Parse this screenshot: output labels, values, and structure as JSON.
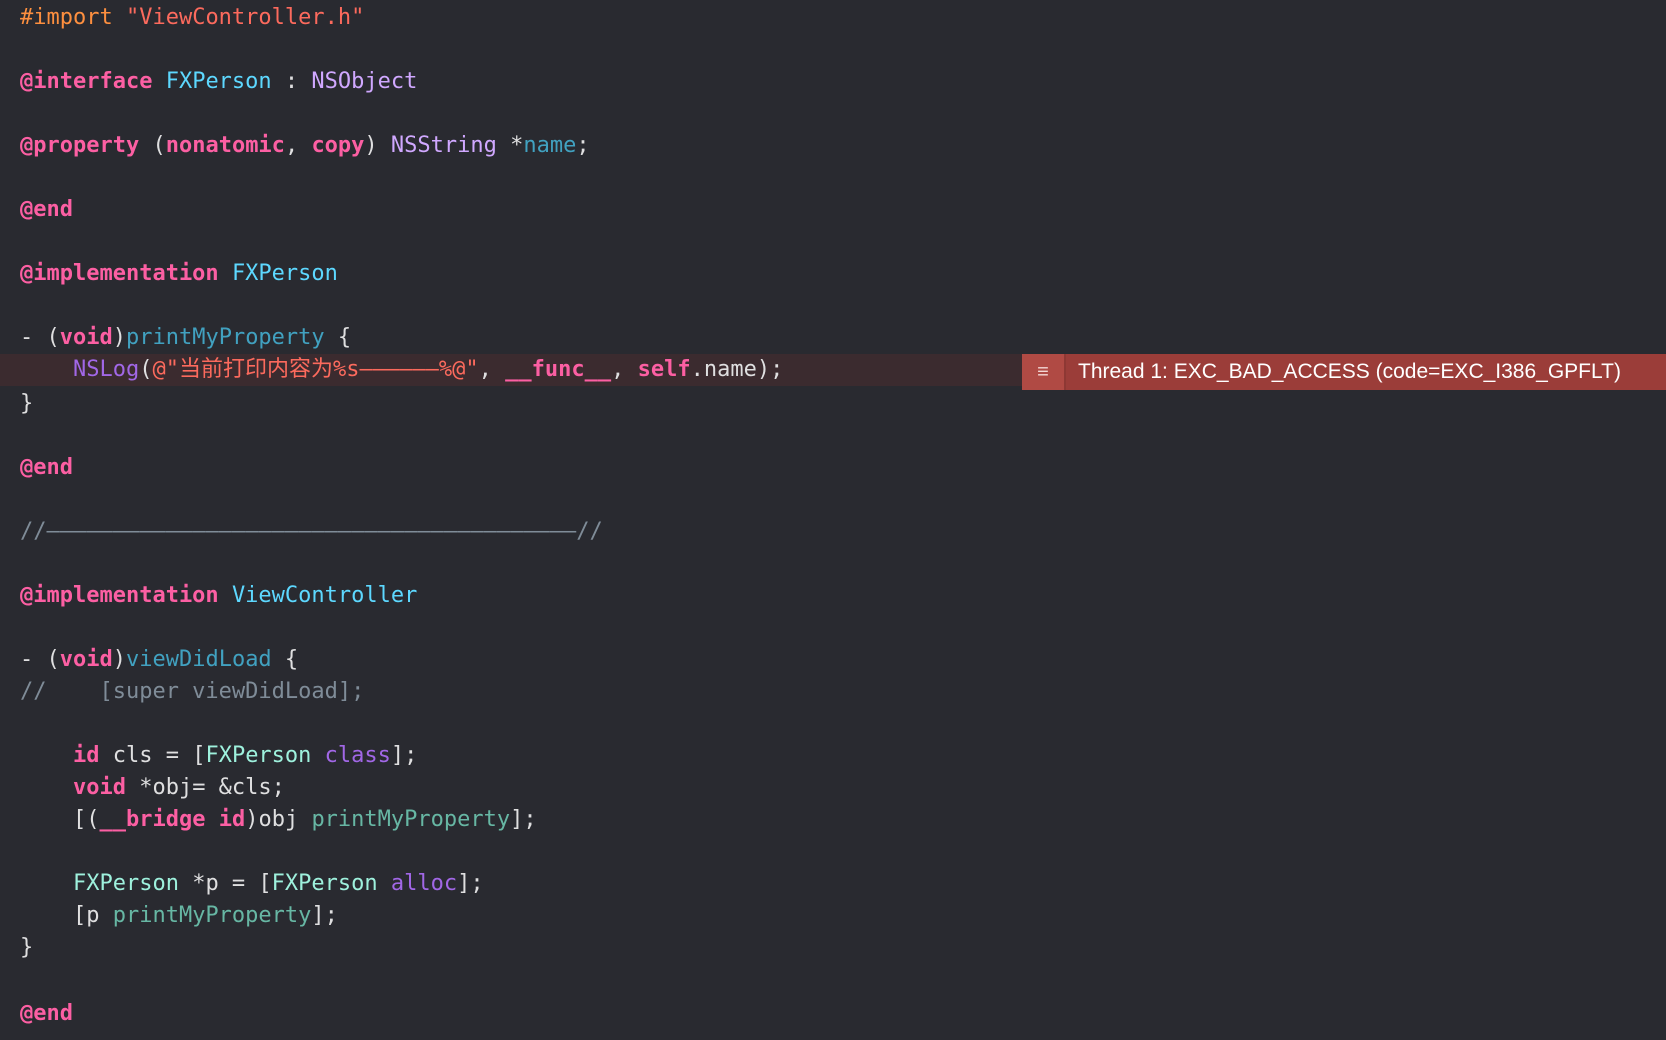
{
  "code_lines": [
    [
      [
        "t-pre",
        "#import "
      ],
      [
        "t-str",
        "\"ViewController.h\""
      ]
    ],
    [],
    [
      [
        "t-kw",
        "@interface"
      ],
      [
        "t-plain",
        " "
      ],
      [
        "t-decl",
        "FXPerson"
      ],
      [
        "t-plain",
        " : "
      ],
      [
        "t-type",
        "NSObject"
      ]
    ],
    [],
    [
      [
        "t-kw",
        "@property"
      ],
      [
        "t-plain",
        " ("
      ],
      [
        "t-kw",
        "nonatomic"
      ],
      [
        "t-plain",
        ", "
      ],
      [
        "t-kw",
        "copy"
      ],
      [
        "t-plain",
        ") "
      ],
      [
        "t-type",
        "NSString"
      ],
      [
        "t-plain",
        " *"
      ],
      [
        "t-prop",
        "name"
      ],
      [
        "t-plain",
        ";"
      ]
    ],
    [],
    [
      [
        "t-kw",
        "@end"
      ]
    ],
    [],
    [
      [
        "t-kw",
        "@implementation"
      ],
      [
        "t-plain",
        " "
      ],
      [
        "t-decl",
        "FXPerson"
      ]
    ],
    [],
    [
      [
        "t-plain",
        "- ("
      ],
      [
        "t-kw",
        "void"
      ],
      [
        "t-plain",
        ")"
      ],
      [
        "t-prop",
        "printMyProperty"
      ],
      [
        "t-plain",
        " {"
      ]
    ],
    [
      [
        "t-plain",
        "    "
      ],
      [
        "t-sysm",
        "NSLog"
      ],
      [
        "t-plain",
        "("
      ],
      [
        "t-str",
        "@\"当前打印内容为%s——————%@\""
      ],
      [
        "t-plain",
        ", "
      ],
      [
        "t-kw",
        "__func__"
      ],
      [
        "t-plain",
        ", "
      ],
      [
        "t-kw",
        "self"
      ],
      [
        "t-plain",
        ".name);"
      ]
    ],
    [
      [
        "t-plain",
        "}"
      ]
    ],
    [],
    [
      [
        "t-kw",
        "@end"
      ]
    ],
    [],
    [
      [
        "t-com",
        "//————————————————————————————————————————//"
      ]
    ],
    [],
    [
      [
        "t-kw",
        "@implementation"
      ],
      [
        "t-plain",
        " "
      ],
      [
        "t-decl",
        "ViewController"
      ]
    ],
    [],
    [
      [
        "t-plain",
        "- ("
      ],
      [
        "t-kw",
        "void"
      ],
      [
        "t-plain",
        ")"
      ],
      [
        "t-prop",
        "viewDidLoad"
      ],
      [
        "t-plain",
        " {"
      ]
    ],
    [
      [
        "t-com",
        "//    [super viewDidLoad];"
      ]
    ],
    [],
    [
      [
        "t-plain",
        "    "
      ],
      [
        "t-kw",
        "id"
      ],
      [
        "t-plain",
        " cls = ["
      ],
      [
        "t-cls",
        "FXPerson"
      ],
      [
        "t-plain",
        " "
      ],
      [
        "t-sysm",
        "class"
      ],
      [
        "t-plain",
        "];"
      ]
    ],
    [
      [
        "t-plain",
        "    "
      ],
      [
        "t-kw",
        "void"
      ],
      [
        "t-plain",
        " *obj= &cls;"
      ]
    ],
    [
      [
        "t-plain",
        "    [("
      ],
      [
        "t-kw",
        "__bridge"
      ],
      [
        "t-plain",
        " "
      ],
      [
        "t-kw",
        "id"
      ],
      [
        "t-plain",
        ")obj "
      ],
      [
        "t-meth",
        "printMyProperty"
      ],
      [
        "t-plain",
        "];"
      ]
    ],
    [],
    [
      [
        "t-plain",
        "    "
      ],
      [
        "t-cls",
        "FXPerson"
      ],
      [
        "t-plain",
        " *p = ["
      ],
      [
        "t-cls",
        "FXPerson"
      ],
      [
        "t-plain",
        " "
      ],
      [
        "t-sysm",
        "alloc"
      ],
      [
        "t-plain",
        "];"
      ]
    ],
    [
      [
        "t-plain",
        "    [p "
      ],
      [
        "t-meth",
        "printMyProperty"
      ],
      [
        "t-plain",
        "];"
      ]
    ],
    [
      [
        "t-plain",
        "}"
      ]
    ],
    [],
    [
      [
        "t-kw",
        "@end"
      ]
    ]
  ],
  "error_banner": {
    "icon": "≡",
    "icon_name": "error-list-icon",
    "message": "Thread 1: EXC_BAD_ACCESS (code=EXC_I386_GPFLT)"
  },
  "colors": {
    "background": "#292a30",
    "error_line": "#3b2b2f",
    "error_banner": "#9b3d39"
  }
}
